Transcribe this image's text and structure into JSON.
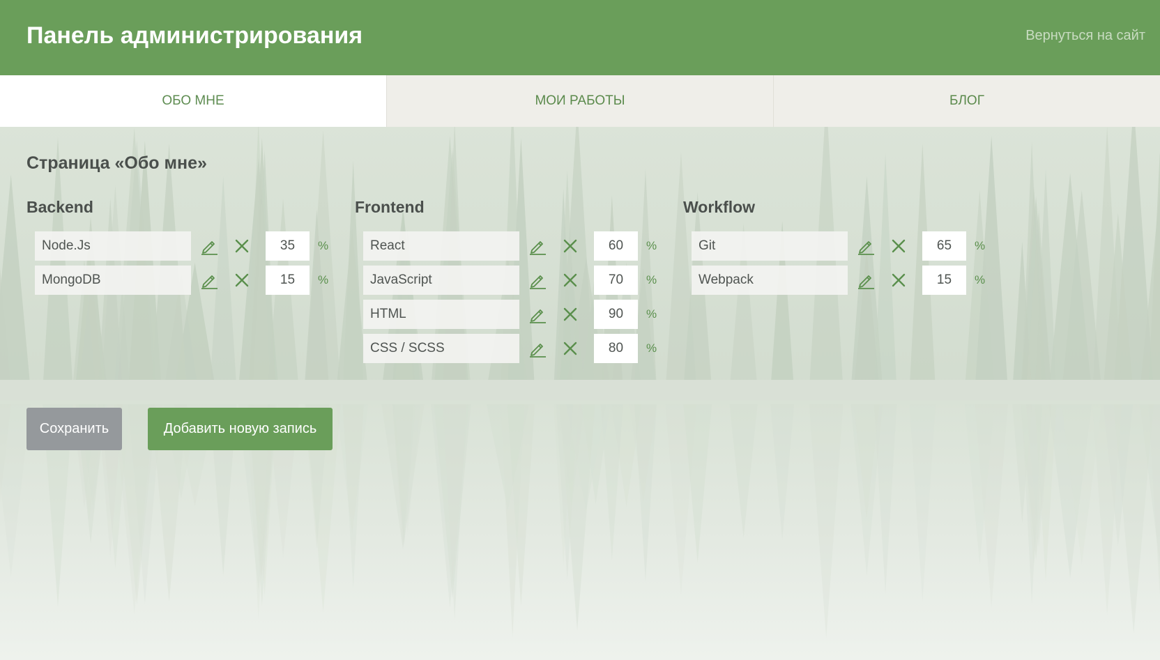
{
  "header": {
    "title": "Панель администрирования",
    "back_link": "Вернуться на сайт"
  },
  "tabs": [
    {
      "label": "Обо мне",
      "active": true
    },
    {
      "label": "Мои работы",
      "active": false
    },
    {
      "label": "Блог",
      "active": false
    }
  ],
  "page": {
    "title": "Страница «Обо мне»"
  },
  "groups": [
    {
      "title": "Backend",
      "skills": [
        {
          "name": "Node.Js",
          "percent": "35"
        },
        {
          "name": "MongoDB",
          "percent": "15"
        }
      ]
    },
    {
      "title": "Frontend",
      "skills": [
        {
          "name": "React",
          "percent": "60"
        },
        {
          "name": "JavaScript",
          "percent": "70"
        },
        {
          "name": "HTML",
          "percent": "90"
        },
        {
          "name": "CSS / SCSS",
          "percent": "80"
        }
      ]
    },
    {
      "title": "Workflow",
      "skills": [
        {
          "name": "Git",
          "percent": "65"
        },
        {
          "name": "Webpack",
          "percent": "15"
        }
      ]
    }
  ],
  "percent_sign": "%",
  "buttons": {
    "save": "Сохранить",
    "add": "Добавить новую запись"
  },
  "icons": {
    "edit": "pencil-icon",
    "delete": "close-icon"
  },
  "colors": {
    "brand_green": "#6a9e5a",
    "save_gray": "#95999c",
    "icon_green": "#5a8f4c"
  }
}
